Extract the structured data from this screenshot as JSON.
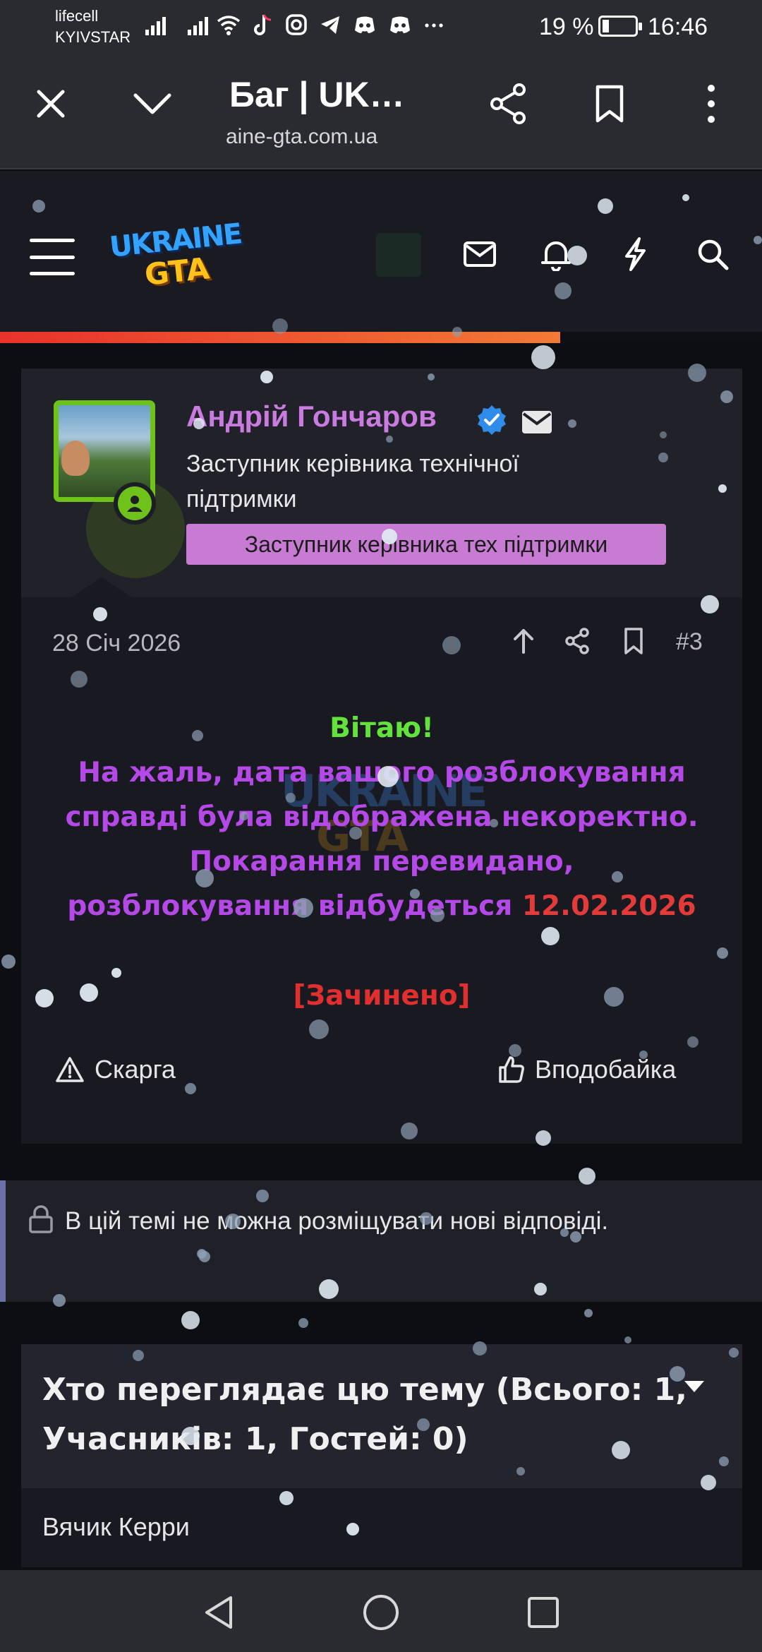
{
  "status_bar": {
    "carrier_1": "lifecell",
    "carrier_2": "KYIVSTAR",
    "battery_percent": "19 %",
    "battery_level": 0.19,
    "time": "16:46",
    "app_icons": [
      "wifi-icon",
      "tiktok-icon",
      "instagram-icon",
      "telegram-icon",
      "discord-icon",
      "discord-icon",
      "more-icon"
    ]
  },
  "browser": {
    "title": "Баг | UK…",
    "url": "aine-gta.com.ua"
  },
  "site_header": {
    "logo_line1": "UKRAINE",
    "logo_line2": "GTA",
    "progress": 0.735
  },
  "post": {
    "author_name": "Андрій Гончаров",
    "author_title": "Заступник керівника технічної підтримки",
    "author_badge": "Заступник керівника тех підтримки",
    "date": "28 Січ 2026",
    "number": "#3",
    "greeting": "Вітаю!",
    "message_line1": "На жаль, дата вашого розблокування",
    "message_line2": "справді була відображена некоректно.",
    "message_line3": "Покарання перевидано,",
    "message_line4": "розблокування відбудеться",
    "unban_date": "12.02.2026",
    "closed": "[Зачинено]",
    "report_label": "Скарга",
    "like_label": "Вподобайка"
  },
  "locked_notice": "В цій темі не можна розміщувати нові відповіді.",
  "viewers": {
    "title": "Хто переглядає цю тему (Всього: 1, Учасників: 1, Гостей: 0)",
    "users": [
      "Вячик Керри"
    ]
  },
  "colors": {
    "accent_green": "#64e23c",
    "accent_purple": "#b549e8",
    "accent_red": "#e33a3a",
    "badge_pink": "#c77bd2",
    "name_purple": "#c97be0"
  }
}
